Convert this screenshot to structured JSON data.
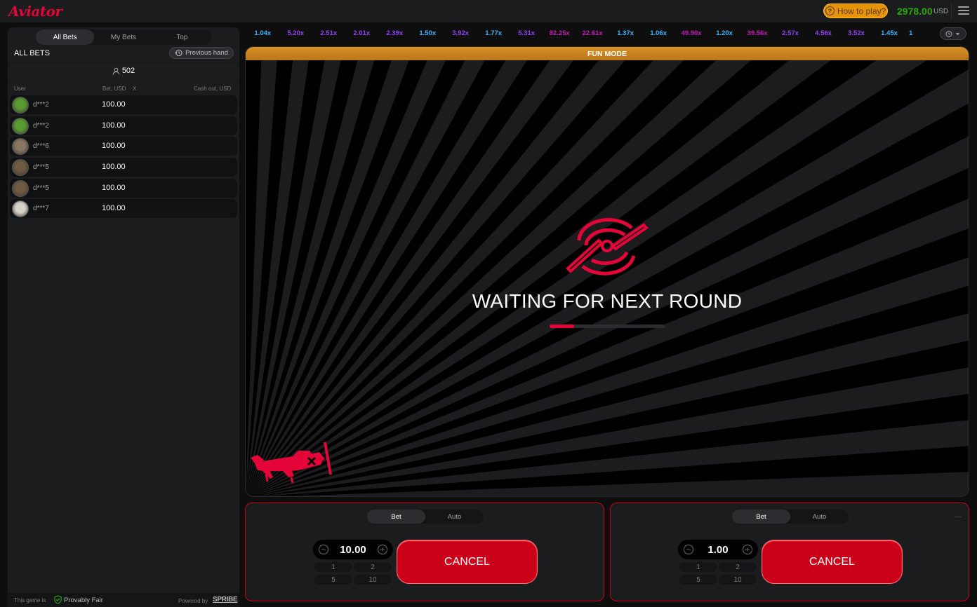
{
  "header": {
    "logo": "Aviator",
    "how_to_play": "How to play?",
    "balance": "2978.00",
    "currency": "USD"
  },
  "left": {
    "tabs": [
      "All Bets",
      "My Bets",
      "Top"
    ],
    "title": "ALL BETS",
    "previous_hand": "Previous hand",
    "bettor_count": "502",
    "columns": {
      "user": "User",
      "bet": "Bet, USD",
      "x": "X",
      "cashout": "Cash out, USD"
    },
    "rows": [
      {
        "user": "d***2",
        "bet": "100.00",
        "avatar_color": "#5a9a30"
      },
      {
        "user": "d***2",
        "bet": "100.00",
        "avatar_color": "#5a9a30"
      },
      {
        "user": "d***6",
        "bet": "100.00",
        "avatar_color": "#8a7763"
      },
      {
        "user": "d***5",
        "bet": "100.00",
        "avatar_color": "#6e5a42"
      },
      {
        "user": "d***5",
        "bet": "100.00",
        "avatar_color": "#6e5a42"
      },
      {
        "user": "d***7",
        "bet": "100.00",
        "avatar_color": "#d7d2c8"
      }
    ],
    "footer": {
      "this_game_is": "This game is",
      "provably_fair": "Provably Fair",
      "powered_by": "Powered by",
      "brand": "SPRIBE"
    }
  },
  "multipliers": [
    {
      "value": "1.04x",
      "color": "#34b4ff"
    },
    {
      "value": "5.20x",
      "color": "#913ef8"
    },
    {
      "value": "2.51x",
      "color": "#913ef8"
    },
    {
      "value": "2.01x",
      "color": "#913ef8"
    },
    {
      "value": "2.39x",
      "color": "#913ef8"
    },
    {
      "value": "1.50x",
      "color": "#34b4ff"
    },
    {
      "value": "3.92x",
      "color": "#913ef8"
    },
    {
      "value": "1.77x",
      "color": "#34b4ff"
    },
    {
      "value": "5.31x",
      "color": "#913ef8"
    },
    {
      "value": "82.25x",
      "color": "#c017b4"
    },
    {
      "value": "22.61x",
      "color": "#c017b4"
    },
    {
      "value": "1.37x",
      "color": "#34b4ff"
    },
    {
      "value": "1.06x",
      "color": "#34b4ff"
    },
    {
      "value": "49.90x",
      "color": "#c017b4"
    },
    {
      "value": "1.20x",
      "color": "#34b4ff"
    },
    {
      "value": "39.56x",
      "color": "#c017b4"
    },
    {
      "value": "2.57x",
      "color": "#913ef8"
    },
    {
      "value": "4.56x",
      "color": "#913ef8"
    },
    {
      "value": "3.52x",
      "color": "#913ef8"
    },
    {
      "value": "1.45x",
      "color": "#34b4ff"
    },
    {
      "value": "1",
      "color": "#34b4ff"
    }
  ],
  "game": {
    "fun_mode": "FUN MODE",
    "status": "WAITING FOR NEXT ROUND",
    "loading_progress": 0.21
  },
  "bet_panels": [
    {
      "tabs": [
        "Bet",
        "Auto"
      ],
      "amount": "10.00",
      "quick": [
        "1",
        "2",
        "5",
        "10"
      ],
      "action": "CANCEL"
    },
    {
      "tabs": [
        "Bet",
        "Auto"
      ],
      "amount": "1.00",
      "quick": [
        "1",
        "2",
        "5",
        "10"
      ],
      "action": "CANCEL"
    }
  ]
}
